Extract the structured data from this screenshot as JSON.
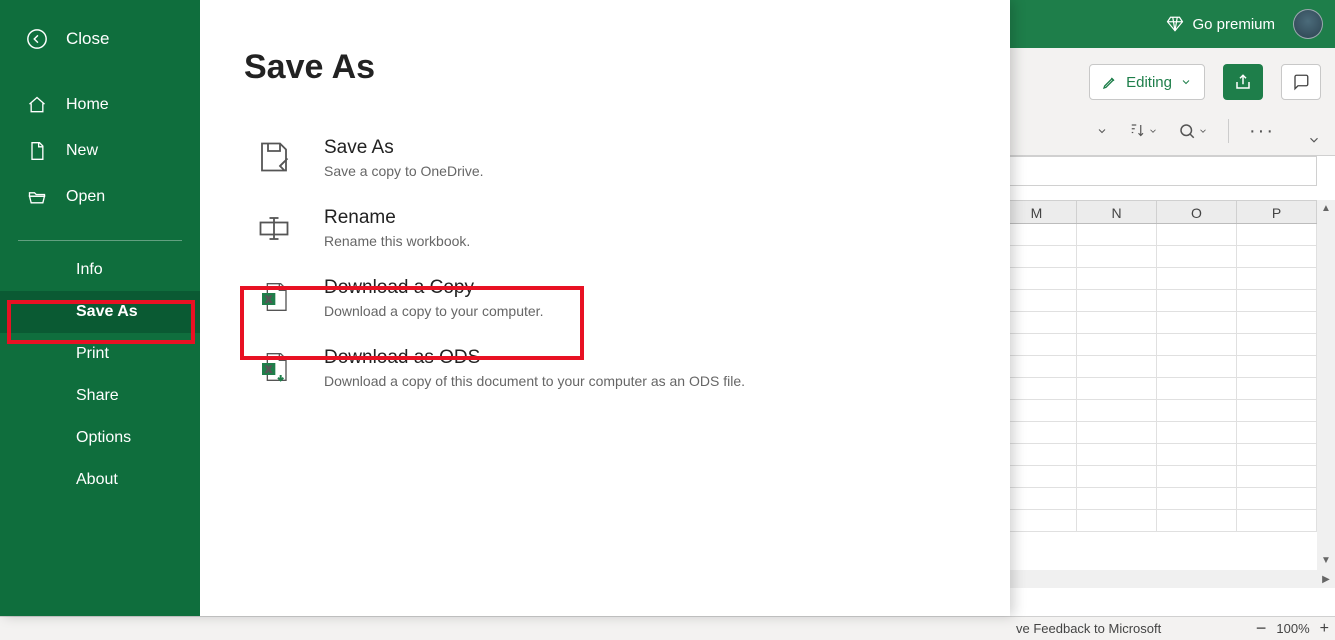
{
  "titlebar": {
    "premium_label": "Go premium"
  },
  "ribbon": {
    "editing_label": "Editing",
    "zoom_percent": "100%"
  },
  "statusbar": {
    "feedback_label": "ve Feedback to Microsoft",
    "zoom": "100%"
  },
  "grid": {
    "columns": [
      "M",
      "N",
      "O",
      "P"
    ]
  },
  "backstage": {
    "back_label": "Close",
    "title": "Save As",
    "nav_group1": [
      {
        "id": "home",
        "label": "Home"
      },
      {
        "id": "new",
        "label": "New"
      },
      {
        "id": "open",
        "label": "Open"
      }
    ],
    "nav_group2": [
      {
        "id": "info",
        "label": "Info"
      },
      {
        "id": "saveas",
        "label": "Save As",
        "selected": true
      },
      {
        "id": "print",
        "label": "Print"
      },
      {
        "id": "share",
        "label": "Share"
      },
      {
        "id": "options",
        "label": "Options"
      },
      {
        "id": "about",
        "label": "About"
      }
    ],
    "options": [
      {
        "id": "saveas",
        "title": "Save As",
        "desc": "Save a copy to OneDrive."
      },
      {
        "id": "rename",
        "title": "Rename",
        "desc": "Rename this workbook."
      },
      {
        "id": "download",
        "title": "Download a Copy",
        "desc": "Download a copy to your computer."
      },
      {
        "id": "ods",
        "title": "Download as ODS",
        "desc": "Download a copy of this document to your computer as an ODS file."
      }
    ]
  },
  "annotations": {
    "highlight_nav": "Save As",
    "highlight_option": "Download a Copy"
  }
}
